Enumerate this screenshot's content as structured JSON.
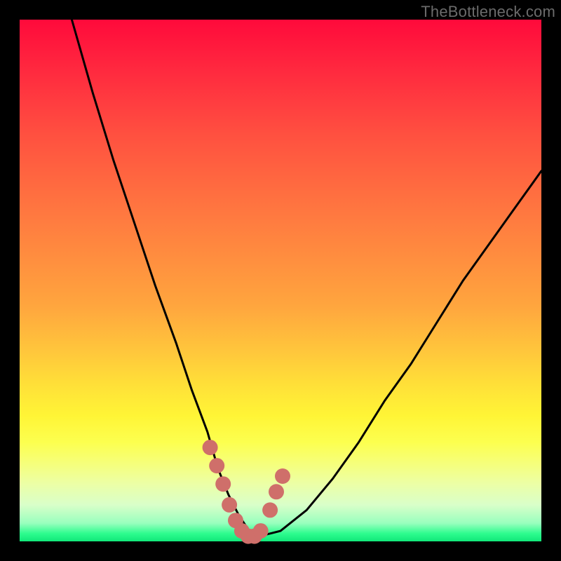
{
  "watermark": "TheBottleneck.com",
  "chart_data": {
    "type": "line",
    "title": "",
    "xlabel": "",
    "ylabel": "",
    "xlim": [
      0,
      100
    ],
    "ylim": [
      0,
      100
    ],
    "grid": false,
    "series": [
      {
        "name": "bottleneck-curve",
        "x": [
          10,
          14,
          18,
          22,
          26,
          30,
          33,
          36,
          38,
          40,
          42,
          44,
          46,
          50,
          55,
          60,
          65,
          70,
          75,
          80,
          85,
          90,
          95,
          100
        ],
        "y": [
          100,
          86,
          73,
          61,
          49,
          38,
          29,
          21,
          14,
          9,
          5,
          2,
          1,
          2,
          6,
          12,
          19,
          27,
          34,
          42,
          50,
          57,
          64,
          71
        ]
      }
    ],
    "markers": {
      "name": "highlight-dots",
      "x": [
        36.5,
        37.8,
        39.0,
        40.2,
        41.4,
        42.6,
        43.8,
        45.0,
        46.2,
        48.0,
        49.2,
        50.4
      ],
      "y": [
        18.0,
        14.5,
        11.0,
        7.0,
        4.0,
        2.0,
        1.0,
        1.0,
        2.0,
        6.0,
        9.5,
        12.5
      ]
    },
    "colors": {
      "curve": "#000000",
      "markers": "#cf6f6a",
      "gradient_top": "#ff0a3b",
      "gradient_bottom": "#11e87a"
    }
  }
}
